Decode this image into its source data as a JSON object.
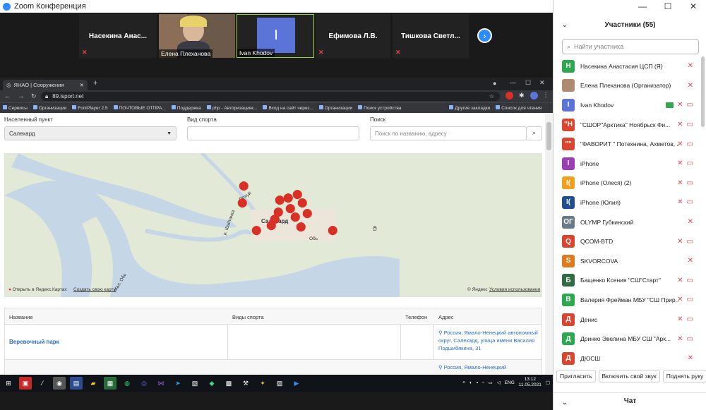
{
  "zoom": {
    "title": "Zoom Конференция",
    "window_controls": [
      "—",
      "☐",
      "✕"
    ]
  },
  "videos": [
    {
      "name": "Насекина  Анас...",
      "muted": true
    },
    {
      "label": "Елена Плеханова",
      "muted": true,
      "has_photo": true
    },
    {
      "initial": "I",
      "label": "Ivan Khodov",
      "active": true
    },
    {
      "name": "Ефимова Л.В.",
      "muted": true
    },
    {
      "name": "Тишкова  Светл...",
      "muted": true
    }
  ],
  "panel": {
    "title": "Участники (55)",
    "search_placeholder": "Найти участника",
    "participants": [
      {
        "initial": "Н",
        "color": "#2ea84f",
        "name": "Насекина Анастасия ЦСП (Я)",
        "video_off": false
      },
      {
        "initial": "",
        "color": "#b08a70",
        "name": "Елена Плеханова (Организатор)",
        "video_off": false,
        "photo": true
      },
      {
        "initial": "I",
        "color": "#5a74d8",
        "name": "Ivan Khodov",
        "video_off": true,
        "share": true
      },
      {
        "initial": "\"Н",
        "color": "#d9452f",
        "name": "\"СШОР\"Арктика\" Ноябрьск Фи...",
        "video_off": true
      },
      {
        "initial": "\"\"",
        "color": "#d9452f",
        "name": "\"ФАВОРИТ \" Потехнина, Ахметов, ...",
        "video_off": true
      },
      {
        "initial": "I",
        "color": "#9b3fb5",
        "name": "iPhone",
        "video_off": true
      },
      {
        "initial": "I(",
        "color": "#f0a01e",
        "name": "iPhone (Олеся) (2)",
        "video_off": true
      },
      {
        "initial": "I(",
        "color": "#1f4f8f",
        "name": "iPhone (Юлия)",
        "video_off": true
      },
      {
        "initial": "ОГ",
        "color": "#6b7a8a",
        "name": "OLYMP Губкинский",
        "video_off": false
      },
      {
        "initial": "Q",
        "color": "#d9452f",
        "name": "QCOM-BTD",
        "video_off": true
      },
      {
        "initial": "S",
        "color": "#e07a1e",
        "name": "SKVORCOVA",
        "video_off": false
      },
      {
        "initial": "Б",
        "color": "#2f6b45",
        "name": "Бащенко Ксения \"СШ\"Старт\"",
        "video_off": true
      },
      {
        "initial": "В",
        "color": "#2ea84f",
        "name": "Валерия Фрейман МБУ \"СШ Прир...",
        "video_off": true
      },
      {
        "initial": "Д",
        "color": "#d9452f",
        "name": "Денис",
        "video_off": true
      },
      {
        "initial": "Д",
        "color": "#2ea84f",
        "name": "Дринко Эвелина МБУ СШ \"Арк...",
        "video_off": true
      },
      {
        "initial": "Д",
        "color": "#d9452f",
        "name": "ДЮСШ",
        "video_off": false
      }
    ],
    "buttons": [
      "Пригласить",
      "Включить свой звук",
      "Поднять руку"
    ],
    "chat_title": "Чат"
  },
  "browser": {
    "tab_title": "ЯНАО | Сооружения",
    "url": "89.isport.net",
    "bookmarks": [
      "Сервисы",
      "Организации",
      "ForkPlayer 2.5",
      "ПОЧТОВЫЕ ОТПРА...",
      "Поддержка",
      "php - Авторизацияк...",
      "Вход на сайт через...",
      "Организации",
      "Поиск устройства",
      "Другие закладки",
      "Список для чтения"
    ]
  },
  "page": {
    "settlement_label": "Населенный пункт",
    "settlement_value": "Салехард",
    "sport_label": "Вид спорта",
    "sport_value": "",
    "search_label": "Поиск",
    "search_placeholder": "Поиск по названию, адресу",
    "map": {
      "city": "Салехард",
      "open_link": "Открыть в Яндекс.Картах",
      "create_link": "Создать свою карту",
      "copyright": "© Яндекс",
      "terms": "Условия использования",
      "river_labels": [
        "Полуй",
        "Обь",
        "р. Шайтанка",
        "Мал. Обь"
      ]
    },
    "table": {
      "headers": [
        "Название",
        "Виды спорта",
        "Телефон",
        "Адрес"
      ],
      "rows": [
        {
          "name": "Веревочный парк",
          "sports": "",
          "phone": "",
          "address": "Россия, Ямало-Ненецкий автономный округ, Салехард, улица имени Василия Подшибякина, 31"
        },
        {
          "name": "",
          "sports": "",
          "phone": "",
          "address": "Россия, Ямало-Ненецкий"
        }
      ]
    }
  },
  "taskbar": {
    "lang": "ENG",
    "time": "13:12",
    "date": "11.05.2021"
  }
}
